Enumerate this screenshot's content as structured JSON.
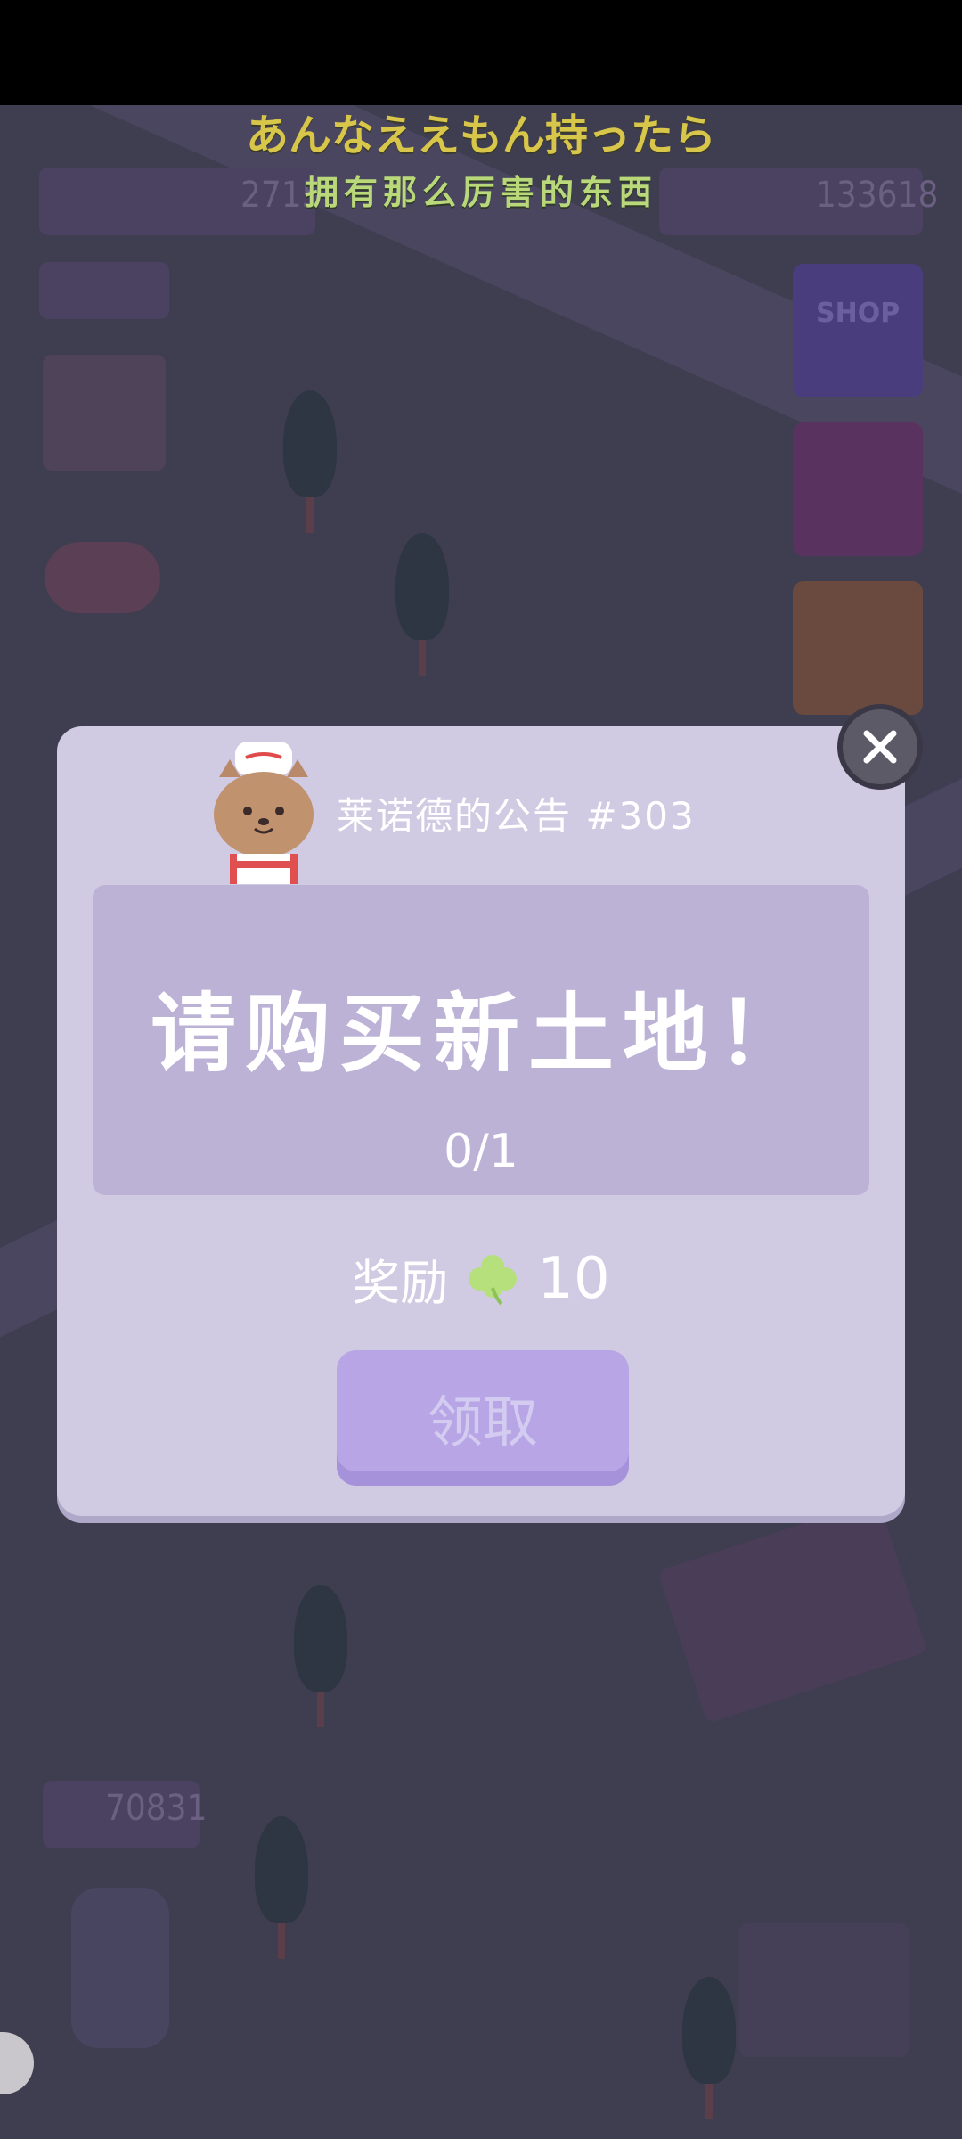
{
  "subtitles": {
    "japanese": "あんなええもん持ったら",
    "chinese": "拥有那么厉害的东西"
  },
  "hud": {
    "clover_count": "2715",
    "coins": "133618",
    "bottom_counter": "70831",
    "shop_label": "SHOP"
  },
  "dialog": {
    "title": "莱诺德的公告 #303",
    "task": "请购买新土地！",
    "progress": "0/1",
    "reward_label": "奖励",
    "reward_amount": "10",
    "claim_button": "领取"
  },
  "colors": {
    "dialog_bg": "#d0cae2",
    "panel_bg": "#bcb2d6",
    "button_bg": "#b7a5e6",
    "clover": "#b6e07c",
    "subtitle_jp": "#d8c64a",
    "subtitle_cn": "#b9d87a"
  },
  "icons": {
    "close": "close-icon",
    "reward": "clover-icon",
    "avatar": "cat-chef-icon"
  }
}
